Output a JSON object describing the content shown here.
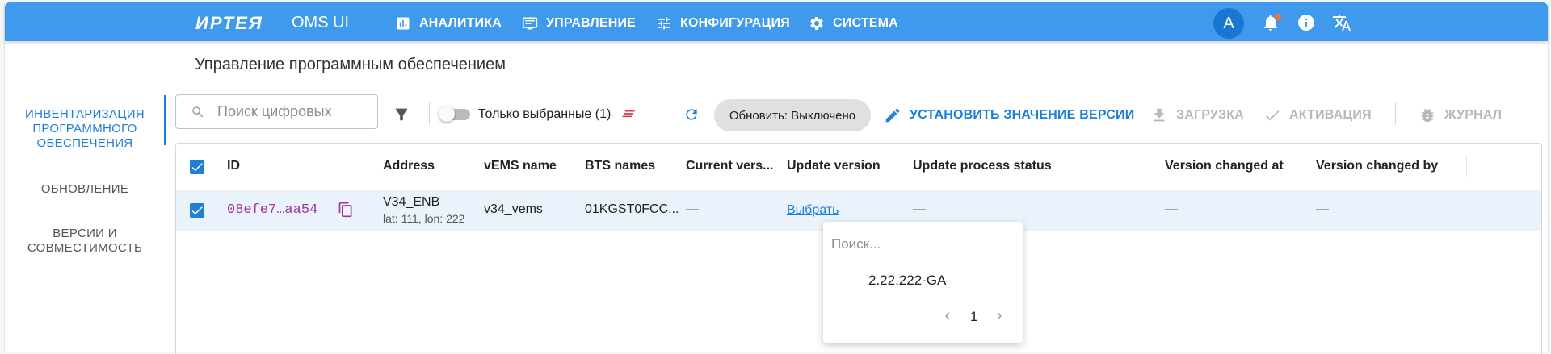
{
  "header": {
    "brand": "ИРТЕЯ",
    "app_name": "OMS UI",
    "nav": [
      {
        "label": "АНАЛИТИКА",
        "icon": "analytics-icon"
      },
      {
        "label": "УПРАВЛЕНИЕ",
        "icon": "management-icon"
      },
      {
        "label": "КОНФИГУРАЦИЯ",
        "icon": "tune-icon"
      },
      {
        "label": "СИСТЕМА",
        "icon": "gear-icon"
      }
    ],
    "avatar_letter": "A",
    "accent_color": "#3f99ec"
  },
  "page": {
    "title": "Управление программным обеспечением"
  },
  "sidebar": {
    "items": [
      {
        "label_lines": [
          "ИНВЕНТАРИЗАЦИЯ",
          "ПРОГРАММНОГО",
          "ОБЕСПЕЧЕНИЯ"
        ],
        "active": true
      },
      {
        "label_lines": [
          "ОБНОВЛЕНИЕ"
        ],
        "active": false
      },
      {
        "label_lines": [
          "ВЕРСИИ И",
          "СОВМЕСТИМОСТЬ"
        ],
        "active": false
      }
    ]
  },
  "toolbar": {
    "search_placeholder": "Поиск цифровых",
    "only_selected_label": "Только выбранные (1)",
    "refresh_chip": "Обновить: Выключено",
    "set_version_label": "УСТАНОВИТЬ ЗНАЧЕНИЕ ВЕРСИИ",
    "upload_label": "ЗАГРУЗКА",
    "activation_label": "АКТИВАЦИЯ",
    "log_label": "ЖУРНАЛ"
  },
  "table": {
    "columns": [
      "ID",
      "Address",
      "vEMS name",
      "BTS names",
      "Current vers...",
      "Update version",
      "Update process status",
      "Version changed at",
      "Version changed by"
    ],
    "rows": [
      {
        "id": "08efe7…aa54",
        "address": "V34_ENB",
        "address_sub": "lat: 111, lon: 222",
        "vems_name": "v34_vems",
        "bts_names": "01KGST0FCC...",
        "current_version": "—",
        "update_version_link": "Выбрать",
        "update_status": "—",
        "changed_at": "—",
        "changed_by": "—",
        "selected": true
      }
    ]
  },
  "version_popup": {
    "search_placeholder": "Поиск...",
    "options": [
      "2.22.222-GA"
    ],
    "page": "1"
  }
}
